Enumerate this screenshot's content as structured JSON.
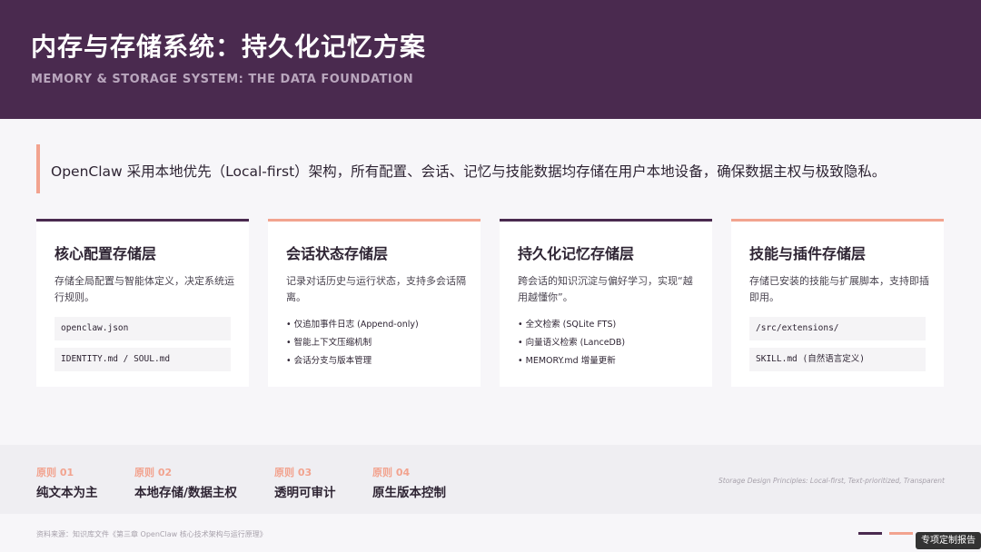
{
  "header": {
    "title": "内存与存储系统：持久化记忆方案",
    "subtitle": "MEMORY & STORAGE SYSTEM: THE DATA FOUNDATION"
  },
  "intro": "OpenClaw 采用本地优先（Local-first）架构，所有配置、会话、记忆与技能数据均存储在用户本地设备，确保数据主权与极致隐私。",
  "cards": [
    {
      "title": "核心配置存储层",
      "desc": "存储全局配置与智能体定义，决定系统运行规则。",
      "codes": [
        "openclaw.json",
        "IDENTITY.md / SOUL.md"
      ]
    },
    {
      "title": "会话状态存储层",
      "desc": "记录对话历史与运行状态，支持多会话隔离。",
      "bullets": [
        "仅追加事件日志 (Append-only)",
        "智能上下文压缩机制",
        "会话分支与版本管理"
      ]
    },
    {
      "title": "持久化记忆存储层",
      "desc": "跨会话的知识沉淀与偏好学习，实现“越用越懂你”。",
      "bullets": [
        "全文检索 (SQLite FTS)",
        "向量语义检索 (LanceDB)",
        "MEMORY.md 增量更新"
      ]
    },
    {
      "title": "技能与插件存储层",
      "desc": "存储已安装的技能与扩展脚本，支持即插即用。",
      "codes": [
        "/src/extensions/",
        "SKILL.md (自然语言定义)"
      ]
    }
  ],
  "principles": [
    {
      "num": "原则 01",
      "text": "纯文本为主"
    },
    {
      "num": "原则 02",
      "text": "本地存储/数据主权"
    },
    {
      "num": "原则 03",
      "text": "透明可审计"
    },
    {
      "num": "原则 04",
      "text": "原生版本控制"
    }
  ],
  "principles_note": "Storage Design Principles: Local-first, Text-prioritized, Transparent",
  "source": "资料来源：知识库文件《第三章 OpenClaw 核心技术架构与运行原理》",
  "watermark": "专项定制报告",
  "colors": {
    "primary": "#4a2a4f",
    "accent": "#f2a38f"
  }
}
